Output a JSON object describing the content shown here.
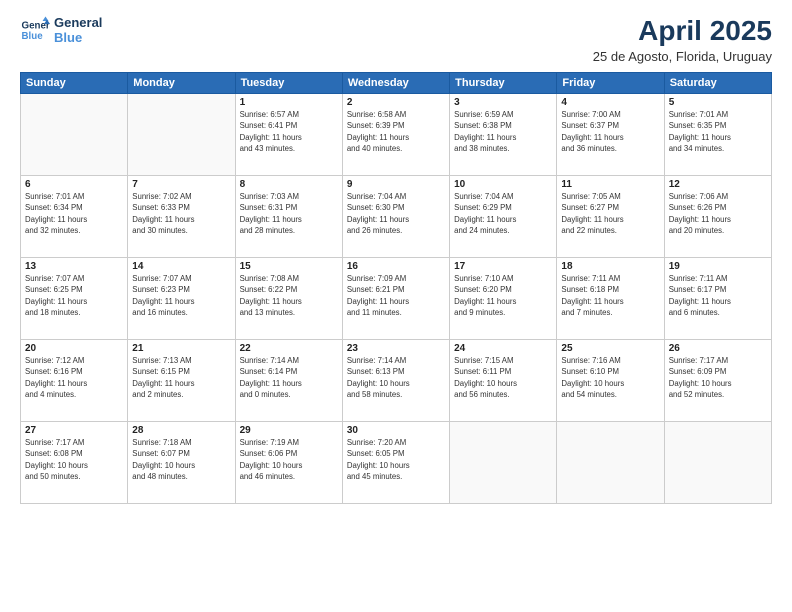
{
  "header": {
    "logo_line1": "General",
    "logo_line2": "Blue",
    "month": "April 2025",
    "location": "25 de Agosto, Florida, Uruguay"
  },
  "weekdays": [
    "Sunday",
    "Monday",
    "Tuesday",
    "Wednesday",
    "Thursday",
    "Friday",
    "Saturday"
  ],
  "weeks": [
    [
      {
        "day": "",
        "info": ""
      },
      {
        "day": "",
        "info": ""
      },
      {
        "day": "1",
        "info": "Sunrise: 6:57 AM\nSunset: 6:41 PM\nDaylight: 11 hours\nand 43 minutes."
      },
      {
        "day": "2",
        "info": "Sunrise: 6:58 AM\nSunset: 6:39 PM\nDaylight: 11 hours\nand 40 minutes."
      },
      {
        "day": "3",
        "info": "Sunrise: 6:59 AM\nSunset: 6:38 PM\nDaylight: 11 hours\nand 38 minutes."
      },
      {
        "day": "4",
        "info": "Sunrise: 7:00 AM\nSunset: 6:37 PM\nDaylight: 11 hours\nand 36 minutes."
      },
      {
        "day": "5",
        "info": "Sunrise: 7:01 AM\nSunset: 6:35 PM\nDaylight: 11 hours\nand 34 minutes."
      }
    ],
    [
      {
        "day": "6",
        "info": "Sunrise: 7:01 AM\nSunset: 6:34 PM\nDaylight: 11 hours\nand 32 minutes."
      },
      {
        "day": "7",
        "info": "Sunrise: 7:02 AM\nSunset: 6:33 PM\nDaylight: 11 hours\nand 30 minutes."
      },
      {
        "day": "8",
        "info": "Sunrise: 7:03 AM\nSunset: 6:31 PM\nDaylight: 11 hours\nand 28 minutes."
      },
      {
        "day": "9",
        "info": "Sunrise: 7:04 AM\nSunset: 6:30 PM\nDaylight: 11 hours\nand 26 minutes."
      },
      {
        "day": "10",
        "info": "Sunrise: 7:04 AM\nSunset: 6:29 PM\nDaylight: 11 hours\nand 24 minutes."
      },
      {
        "day": "11",
        "info": "Sunrise: 7:05 AM\nSunset: 6:27 PM\nDaylight: 11 hours\nand 22 minutes."
      },
      {
        "day": "12",
        "info": "Sunrise: 7:06 AM\nSunset: 6:26 PM\nDaylight: 11 hours\nand 20 minutes."
      }
    ],
    [
      {
        "day": "13",
        "info": "Sunrise: 7:07 AM\nSunset: 6:25 PM\nDaylight: 11 hours\nand 18 minutes."
      },
      {
        "day": "14",
        "info": "Sunrise: 7:07 AM\nSunset: 6:23 PM\nDaylight: 11 hours\nand 16 minutes."
      },
      {
        "day": "15",
        "info": "Sunrise: 7:08 AM\nSunset: 6:22 PM\nDaylight: 11 hours\nand 13 minutes."
      },
      {
        "day": "16",
        "info": "Sunrise: 7:09 AM\nSunset: 6:21 PM\nDaylight: 11 hours\nand 11 minutes."
      },
      {
        "day": "17",
        "info": "Sunrise: 7:10 AM\nSunset: 6:20 PM\nDaylight: 11 hours\nand 9 minutes."
      },
      {
        "day": "18",
        "info": "Sunrise: 7:11 AM\nSunset: 6:18 PM\nDaylight: 11 hours\nand 7 minutes."
      },
      {
        "day": "19",
        "info": "Sunrise: 7:11 AM\nSunset: 6:17 PM\nDaylight: 11 hours\nand 6 minutes."
      }
    ],
    [
      {
        "day": "20",
        "info": "Sunrise: 7:12 AM\nSunset: 6:16 PM\nDaylight: 11 hours\nand 4 minutes."
      },
      {
        "day": "21",
        "info": "Sunrise: 7:13 AM\nSunset: 6:15 PM\nDaylight: 11 hours\nand 2 minutes."
      },
      {
        "day": "22",
        "info": "Sunrise: 7:14 AM\nSunset: 6:14 PM\nDaylight: 11 hours\nand 0 minutes."
      },
      {
        "day": "23",
        "info": "Sunrise: 7:14 AM\nSunset: 6:13 PM\nDaylight: 10 hours\nand 58 minutes."
      },
      {
        "day": "24",
        "info": "Sunrise: 7:15 AM\nSunset: 6:11 PM\nDaylight: 10 hours\nand 56 minutes."
      },
      {
        "day": "25",
        "info": "Sunrise: 7:16 AM\nSunset: 6:10 PM\nDaylight: 10 hours\nand 54 minutes."
      },
      {
        "day": "26",
        "info": "Sunrise: 7:17 AM\nSunset: 6:09 PM\nDaylight: 10 hours\nand 52 minutes."
      }
    ],
    [
      {
        "day": "27",
        "info": "Sunrise: 7:17 AM\nSunset: 6:08 PM\nDaylight: 10 hours\nand 50 minutes."
      },
      {
        "day": "28",
        "info": "Sunrise: 7:18 AM\nSunset: 6:07 PM\nDaylight: 10 hours\nand 48 minutes."
      },
      {
        "day": "29",
        "info": "Sunrise: 7:19 AM\nSunset: 6:06 PM\nDaylight: 10 hours\nand 46 minutes."
      },
      {
        "day": "30",
        "info": "Sunrise: 7:20 AM\nSunset: 6:05 PM\nDaylight: 10 hours\nand 45 minutes."
      },
      {
        "day": "",
        "info": ""
      },
      {
        "day": "",
        "info": ""
      },
      {
        "day": "",
        "info": ""
      }
    ]
  ]
}
